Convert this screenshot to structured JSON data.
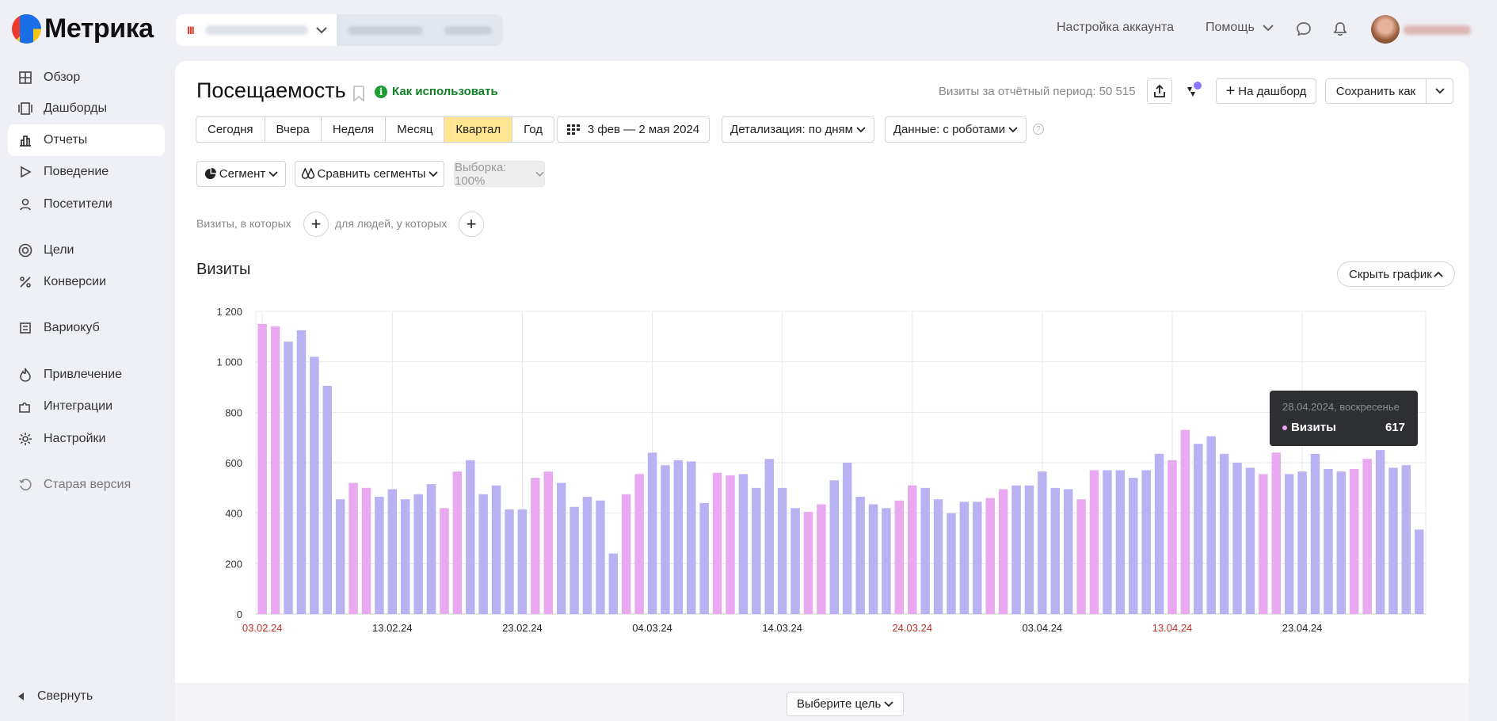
{
  "logo": {
    "text": "Метрика"
  },
  "header": {
    "account_settings": "Настройка аккаунта",
    "help": "Помощь"
  },
  "sidebar": {
    "items": [
      {
        "label": "Обзор",
        "icon": "grid-icon"
      },
      {
        "label": "Дашборды",
        "icon": "dashboards-icon"
      },
      {
        "label": "Отчеты",
        "icon": "bar-chart-icon"
      },
      {
        "label": "Поведение",
        "icon": "play-icon"
      },
      {
        "label": "Посетители",
        "icon": "person-icon"
      },
      {
        "label": "Цели",
        "icon": "target-icon"
      },
      {
        "label": "Конверсии",
        "icon": "percent-icon"
      },
      {
        "label": "Вариокуб",
        "icon": "cube-icon"
      },
      {
        "label": "Привлечение",
        "icon": "flame-icon"
      },
      {
        "label": "Интеграции",
        "icon": "puzzle-icon"
      },
      {
        "label": "Настройки",
        "icon": "gear-icon"
      },
      {
        "label": "Старая версия",
        "icon": "history-icon"
      }
    ],
    "collapse": "Свернуть"
  },
  "report": {
    "title": "Посещаемость",
    "how_to_use": "Как использовать",
    "visits_total": "Визиты за отчётный период: 50 515",
    "to_dashboard": "На дашборд",
    "save_as": "Сохранить как"
  },
  "periods": [
    "Сегодня",
    "Вчера",
    "Неделя",
    "Месяц",
    "Квартал",
    "Год"
  ],
  "period_selected": "Квартал",
  "date_range": "3 фев — 2 мая 2024",
  "detail": "Детализация: по дням",
  "data_mode": "Данные: с роботами",
  "segment": "Сегмент",
  "compare": "Сравнить сегменты",
  "sample": "Выборка: 100%",
  "filters": {
    "visits_where": "Визиты, в которых",
    "people_where": "для людей, у которых"
  },
  "chart_section": {
    "title": "Визиты",
    "hide": "Скрыть график"
  },
  "tooltip": {
    "date": "28.04.2024, воскресенье",
    "series": "Визиты",
    "value": "617"
  },
  "goal_select": "Выберите цель",
  "colors": {
    "weekday": "#b9b2f2",
    "weekend": "#e9a9f1",
    "accent_green": "#118024",
    "selected_period": "#ffe58f",
    "holiday_tick": "#c0302a"
  },
  "chart_data": {
    "type": "bar",
    "title": "Визиты",
    "ylim": [
      0,
      1200
    ],
    "yticks": [
      0,
      200,
      400,
      600,
      800,
      1000,
      1200
    ],
    "ytick_labels": [
      "0",
      "200",
      "400",
      "600",
      "800",
      "1 000",
      "1 200"
    ],
    "xtick_labels": [
      {
        "label": "03.02.24",
        "index": 0,
        "weekend": true
      },
      {
        "label": "13.02.24",
        "index": 10,
        "weekend": false
      },
      {
        "label": "23.02.24",
        "index": 20,
        "weekend": false
      },
      {
        "label": "04.03.24",
        "index": 30,
        "weekend": false
      },
      {
        "label": "14.03.24",
        "index": 40,
        "weekend": false
      },
      {
        "label": "24.03.24",
        "index": 50,
        "weekend": true
      },
      {
        "label": "03.04.24",
        "index": 60,
        "weekend": false
      },
      {
        "label": "13.04.24",
        "index": 70,
        "weekend": true
      },
      {
        "label": "23.04.24",
        "index": 80,
        "weekend": false
      }
    ],
    "first_day_weekday": 5,
    "values": [
      1150,
      1140,
      1080,
      1125,
      1020,
      905,
      455,
      520,
      500,
      465,
      495,
      455,
      475,
      515,
      420,
      565,
      610,
      475,
      510,
      415,
      415,
      540,
      565,
      520,
      425,
      465,
      450,
      240,
      475,
      555,
      640,
      590,
      610,
      605,
      440,
      560,
      550,
      555,
      500,
      615,
      500,
      420,
      405,
      435,
      530,
      600,
      465,
      435,
      420,
      450,
      510,
      500,
      455,
      400,
      445,
      445,
      460,
      495,
      510,
      510,
      565,
      500,
      495,
      455,
      570,
      570,
      570,
      540,
      570,
      635,
      610,
      730,
      675,
      705,
      635,
      600,
      580,
      555,
      640,
      555,
      565,
      635,
      575,
      565,
      575,
      615,
      650,
      580,
      590,
      335
    ]
  }
}
